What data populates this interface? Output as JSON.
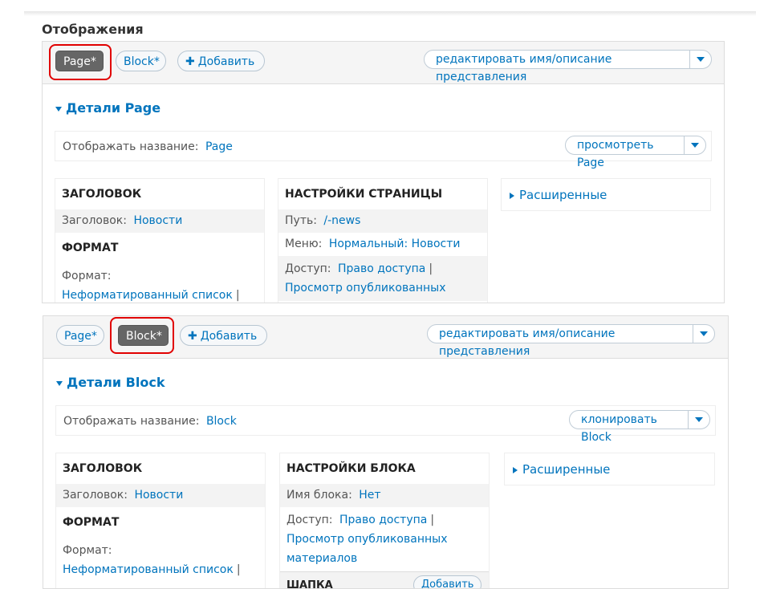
{
  "section_title": "Отображения",
  "accent_color": "#0074bd",
  "highlight_color": "#e10000",
  "panels": [
    {
      "tabs": [
        "Page*",
        "Block*"
      ],
      "active_tab": "Page*",
      "add_label": "Добавить",
      "edit_label": "редактировать имя/описание представления",
      "details_title": "Детали Page",
      "display_name_label": "Отображать название:",
      "display_name_value": "Page",
      "action_label": "просмотреть Page",
      "col1": {
        "heading": "ЗАГОЛОВОК",
        "title_label": "Заголовок:",
        "title_value": "Новости",
        "format_heading": "ФОРМАТ",
        "format_label": "Формат:",
        "format_value": "Неформатированный список"
      },
      "col2": {
        "heading": "НАСТРОЙКИ СТРАНИЦЫ",
        "path_label": "Путь:",
        "path_value": "/-news",
        "menu_label": "Меню:",
        "menu_value": "Нормальный: Новости",
        "access_label": "Доступ:",
        "access_value": "Право доступа",
        "access_value2": "Просмотр опубликованных"
      },
      "advanced_label": "Расширенные"
    },
    {
      "tabs": [
        "Page*",
        "Block*"
      ],
      "active_tab": "Block*",
      "add_label": "Добавить",
      "edit_label": "редактировать имя/описание представления",
      "details_title": "Детали Block",
      "display_name_label": "Отображать название:",
      "display_name_value": "Block",
      "action_label": "клонировать Block",
      "col1": {
        "heading": "ЗАГОЛОВОК",
        "title_label": "Заголовок:",
        "title_value": "Новости",
        "format_heading": "ФОРМАТ",
        "format_label": "Формат:",
        "format_value": "Неформатированный список"
      },
      "col2": {
        "heading": "НАСТРОЙКИ БЛОКА",
        "block_name_label": "Имя блока:",
        "block_name_value": "Нет",
        "access_label": "Доступ:",
        "access_value": "Право доступа",
        "access_value2": "Просмотр опубликованных",
        "access_value3": "материалов",
        "partial_label": "ШАПКА",
        "partial_button": "Добавить"
      },
      "advanced_label": "Расширенные"
    }
  ]
}
